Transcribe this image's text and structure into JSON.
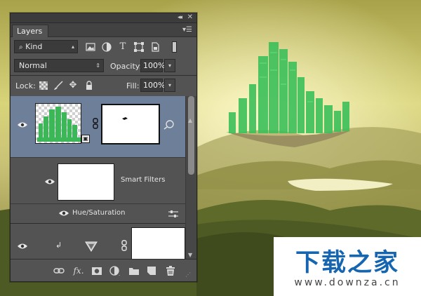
{
  "panel": {
    "tab_label": "Layers",
    "filter_kind": "Kind",
    "blend_mode": "Normal",
    "opacity_label": "Opacity:",
    "opacity_value": "100%",
    "lock_label": "Lock:",
    "fill_label": "Fill:",
    "fill_value": "100%"
  },
  "layers": {
    "smart_filters_label": "Smart Filters",
    "hue_sat_label": "Hue/Saturation"
  },
  "bottom_bar": {
    "fx_label": "fx"
  },
  "watermark": {
    "title": "下载之家",
    "url": "www.downza.cn"
  },
  "colors": {
    "panel_bg": "#535353",
    "selected_layer": "#6e7f99",
    "watermark_blue": "#1565b0"
  }
}
